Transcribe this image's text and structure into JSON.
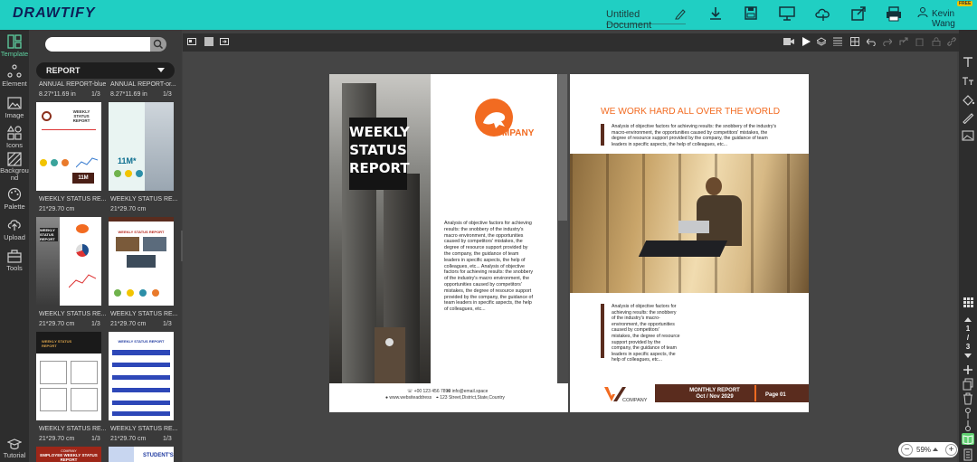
{
  "app": {
    "logo": "DRAWTIFY",
    "doc_title": "Untitled Document",
    "user_name": "Kevin Wang",
    "badge": "FREE"
  },
  "left_rail": [
    {
      "label": "Template",
      "icon": "template-icon"
    },
    {
      "label": "Element",
      "icon": "element-icon"
    },
    {
      "label": "Image",
      "icon": "image-icon"
    },
    {
      "label": "Icons",
      "icon": "shapes-icon"
    },
    {
      "label": "Backgrou\nnd",
      "icon": "background-icon"
    },
    {
      "label": "Palette",
      "icon": "palette-icon"
    },
    {
      "label": "Upload",
      "icon": "upload-icon"
    },
    {
      "label": "Tools",
      "icon": "toolbox-icon"
    },
    {
      "label": "Tutorial",
      "icon": "graduation-cap-icon"
    }
  ],
  "panel": {
    "search_placeholder": "",
    "category": "REPORT",
    "top_items": [
      {
        "name": "ANNUAL REPORT-blue",
        "size": "8.27*11.69 in",
        "pages": "1/3"
      },
      {
        "name": "ANNUAL REPORT-or...",
        "size": "8.27*11.69 in",
        "pages": "1/3"
      }
    ],
    "templates": [
      {
        "name": "WEEKLY STATUS RE...",
        "size": "21*29.70 cm",
        "pages": "1/3",
        "thumb": "weekly-1",
        "title": "WEEKLY STATUS REPORT"
      },
      {
        "name": "WEEKLY STATUS RE...",
        "size": "21*29.70 cm",
        "pages": "1/3",
        "thumb": "weekly-2",
        "title": "11M*"
      },
      {
        "name": "WEEKLY STATUS RE...",
        "size": "21*29.70 cm",
        "pages": "1/3",
        "thumb": "weekly-3",
        "title": "WEEKLY STATUS REPORT"
      },
      {
        "name": "WEEKLY STATUS RE...",
        "size": "21*29.70 cm",
        "pages": "1/3",
        "thumb": "weekly-4",
        "title": "WEEKLY STATUS REPORT"
      },
      {
        "name": "WEEKLY STATUS RE...",
        "size": "21*29.70 cm",
        "pages": "1/3",
        "thumb": "weekly-5",
        "title": "WEEKLY STATUS REPORT"
      },
      {
        "name": "WEEKLY STATUS RE...",
        "size": "21*29.70 cm",
        "pages": "1/3",
        "thumb": "weekly-6",
        "title": "WEEKLY STATUS REPORT"
      }
    ],
    "bottom_items": [
      {
        "title": "EMPLOYEE WEEKLY STATUS REPORT",
        "company": "COMPANY"
      },
      {
        "title": "STUDENT'S"
      }
    ]
  },
  "top_toolbar": [
    {
      "label": "Download",
      "icon": "download-icon"
    },
    {
      "label": "Save",
      "icon": "save-icon"
    },
    {
      "label": "Present",
      "icon": "monitor-icon"
    },
    {
      "label": "Cloud",
      "icon": "cloud-icon"
    },
    {
      "label": "Share",
      "icon": "share-icon"
    },
    {
      "label": "Print",
      "icon": "print-icon"
    }
  ],
  "page_left": {
    "title_line1": "WEEKLY",
    "title_line2": "STATUS",
    "title_line3": "REPORT",
    "logo_text": "COMPANY",
    "body": "Analysis of objective factors for achieving results: the snobbery of the industry's macro environment, the opportunities caused by competitors' mistakes, the degree of resource support provided by the company, the guidance of team leaders in specific aspects, the help of colleagues, etc... Analysis of objective factors for achieving results: the snobbery of the industry's macro environment, the opportunities caused by competitors' mistakes, the degree of resource support provided by the company, the guidance of team leaders in specific aspects, the help of colleagues, etc...",
    "phone": "+00 123 456 7890",
    "email": "info@email.space",
    "website": "www.websiteaddress",
    "address": "123 Street,District,State,Country"
  },
  "page_right": {
    "heading": "WE WORK HARD ALL OVER THE WORLD",
    "para1": "Analysis of objective factors for achieving results: the snobbery of the industry's macro-environment, the opportunities caused by competitors' mistakes, the degree of resource support provided by the company, the guidance of team leaders in specific aspects, the help of colleagues, etc...",
    "para2": "Analysis of objective factors for achieving results: the snobbery of the industry's macro-environment, the opportunities caused by competitors' mistakes, the degree of resource support provided by the company, the guidance of team leaders in specific aspects, the help of colleagues, etc...",
    "footer_logo": "COMPANY",
    "footer_title": "MONTHLY REPORT",
    "footer_date": "Oct / Nov 2029",
    "footer_page": "Page 01"
  },
  "pager": {
    "current": "1",
    "sep": "/",
    "total": "3"
  },
  "zoom": {
    "value": "59%",
    "minus": "−",
    "plus": "+"
  },
  "colors": {
    "teal": "#20cfc3",
    "orange": "#f26b21",
    "brown": "#5a2c1e"
  }
}
